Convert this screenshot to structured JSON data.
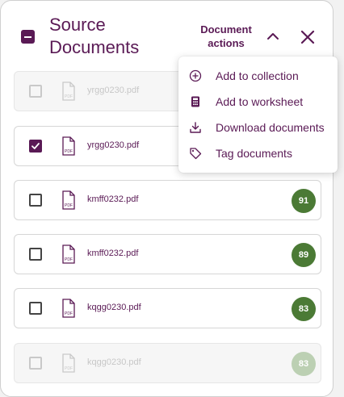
{
  "header": {
    "title": "Source Documents",
    "document_actions": "Document actions"
  },
  "documents": [
    {
      "filename": "yrgg0230.pdf",
      "checked": false,
      "faded": true,
      "score": ""
    },
    {
      "filename": "yrgg0230.pdf",
      "checked": true,
      "faded": false,
      "score": ""
    },
    {
      "filename": "kmff0232.pdf",
      "checked": false,
      "faded": false,
      "score": "91"
    },
    {
      "filename": "kmff0232.pdf",
      "checked": false,
      "faded": false,
      "score": "89"
    },
    {
      "filename": "kqgg0230.pdf",
      "checked": false,
      "faded": false,
      "score": "83"
    },
    {
      "filename": "kqgg0230.pdf",
      "checked": false,
      "faded": true,
      "score": "83"
    }
  ],
  "menu": {
    "items": [
      {
        "label": "Add to collection",
        "icon": "add-circle-icon"
      },
      {
        "label": "Add to worksheet",
        "icon": "worksheet-icon"
      },
      {
        "label": "Download documents",
        "icon": "download-icon"
      },
      {
        "label": "Tag documents",
        "icon": "tag-icon"
      }
    ]
  },
  "colors": {
    "brand": "#5a1a55",
    "score_green": "#4b7a35",
    "score_faded": "#bcd0b3"
  }
}
